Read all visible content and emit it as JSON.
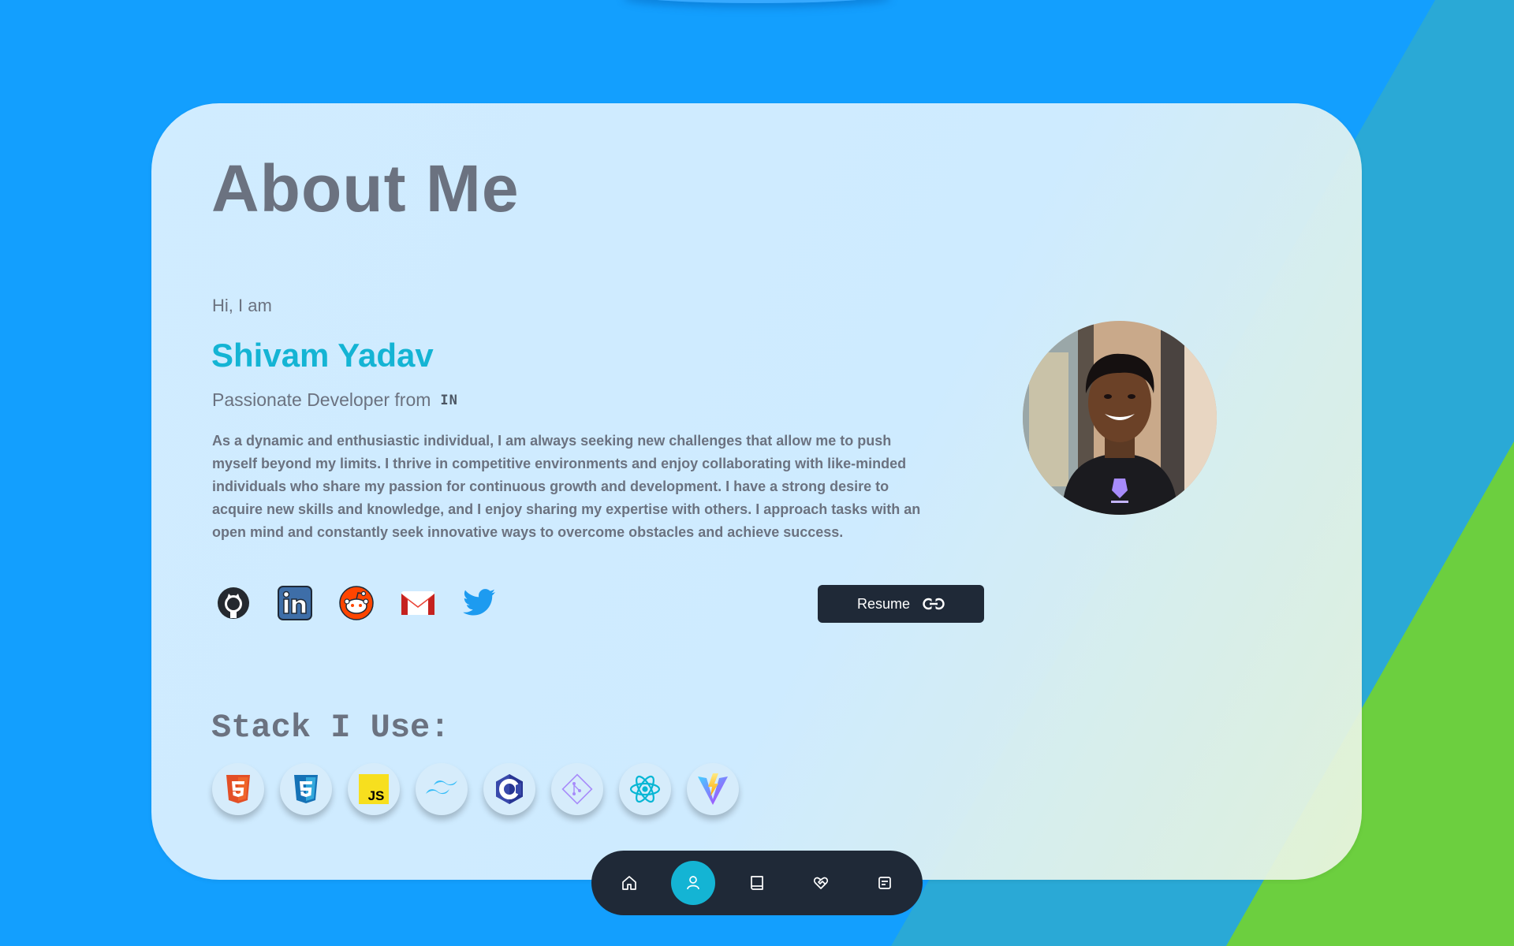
{
  "about": {
    "title": "About Me",
    "greeting": "Hi, I am",
    "name": "Shivam Yadav",
    "subtitle": "Passionate Developer from",
    "country_code": "IN",
    "bio": "As a dynamic and enthusiastic individual, I am always seeking new challenges that allow me to push myself beyond my limits. I thrive in competitive environments and enjoy collaborating with like-minded individuals who share my passion for continuous growth and development. I have a strong desire to acquire new skills and knowledge, and I enjoy sharing my expertise with others. I approach tasks with an open mind and constantly seek innovative ways to overcome obstacles and achieve success."
  },
  "socials": [
    "github-icon",
    "linkedin-icon",
    "reddit-icon",
    "gmail-icon",
    "twitter-icon"
  ],
  "resume": {
    "label": "Resume",
    "icon": "link-icon"
  },
  "stack": {
    "title": "Stack I Use:",
    "items": [
      "html5-icon",
      "css3-icon",
      "javascript-icon",
      "tailwind-icon",
      "c-icon",
      "git-icon",
      "react-icon",
      "vite-icon"
    ]
  },
  "nav": {
    "items": [
      "home-icon",
      "user-icon",
      "book-icon",
      "heart-handshake-icon",
      "notes-icon"
    ],
    "active": "user-icon"
  },
  "colors": {
    "background": "#139ffe",
    "accent": "#14b4d4",
    "dark": "#1f2937",
    "muted_text": "#6b7280",
    "green_stripe": "#6ccf3f"
  }
}
